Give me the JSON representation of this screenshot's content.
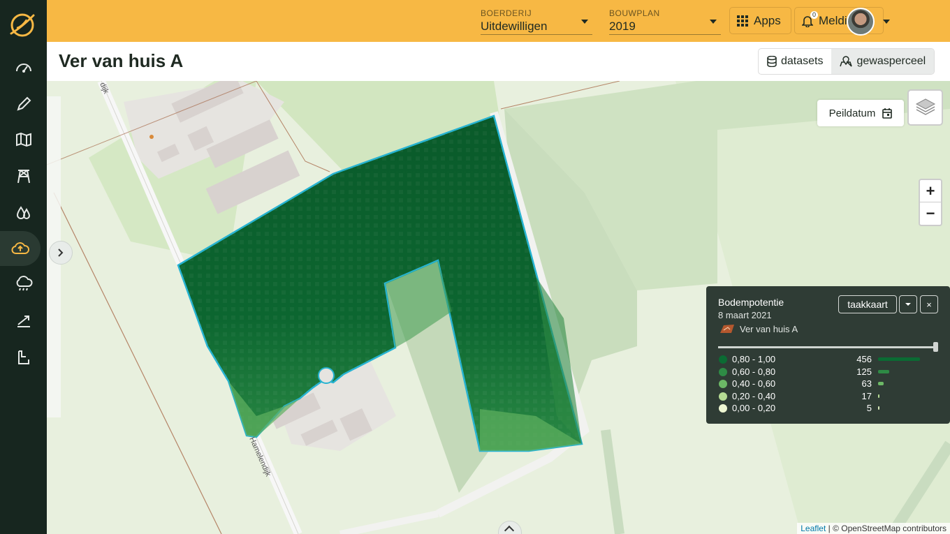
{
  "header": {
    "boerderij_label": "BOERDERIJ",
    "boerderij_value": "Uitdewilligen",
    "bouwplan_label": "BOUWPLAN",
    "bouwplan_value": "2019",
    "apps_label": "Apps",
    "notifications_label": "Meldingen",
    "notifications_count": "0"
  },
  "sidebar": {
    "items": [
      {
        "icon": "dashboard-icon"
      },
      {
        "icon": "pencil-icon"
      },
      {
        "icon": "map-icon"
      },
      {
        "icon": "tower-icon"
      },
      {
        "icon": "drops-icon"
      },
      {
        "icon": "cloud-upload-icon",
        "active": true
      },
      {
        "icon": "rain-cloud-icon"
      },
      {
        "icon": "trend-icon"
      },
      {
        "icon": "report-icon"
      }
    ]
  },
  "title": {
    "page_title": "Ver van huis A",
    "datasets_label": "datasets",
    "gewasperceel_label": "gewasperceel"
  },
  "map": {
    "peildatum_label": "Peildatum",
    "zoom_in": "+",
    "zoom_out": "−",
    "road_label_1": "Hamelendijk",
    "road_label_2": "dijk",
    "attribution_link": "Leaflet",
    "attribution_text": "| © OpenStreetMap contributors"
  },
  "legend": {
    "title": "Bodempotentie",
    "date": "8 maart 2021",
    "field": "Ver van huis A",
    "taakkaart_label": "taakkaart",
    "close_label": "×",
    "classes": [
      {
        "range": "0,80 - 1,00",
        "count": "456",
        "color": "#0b6b33",
        "fraction": 1.0
      },
      {
        "range": "0,60 - 0,80",
        "count": "125",
        "color": "#2e8b45",
        "fraction": 0.27
      },
      {
        "range": "0,40 - 0,60",
        "count": "63",
        "color": "#6cb866",
        "fraction": 0.14
      },
      {
        "range": "0,20 - 0,40",
        "count": "17",
        "color": "#b6dc94",
        "fraction": 0.04
      },
      {
        "range": "0,00 - 0,20",
        "count": "5",
        "color": "#eef6d2",
        "fraction": 0.01
      }
    ]
  }
}
